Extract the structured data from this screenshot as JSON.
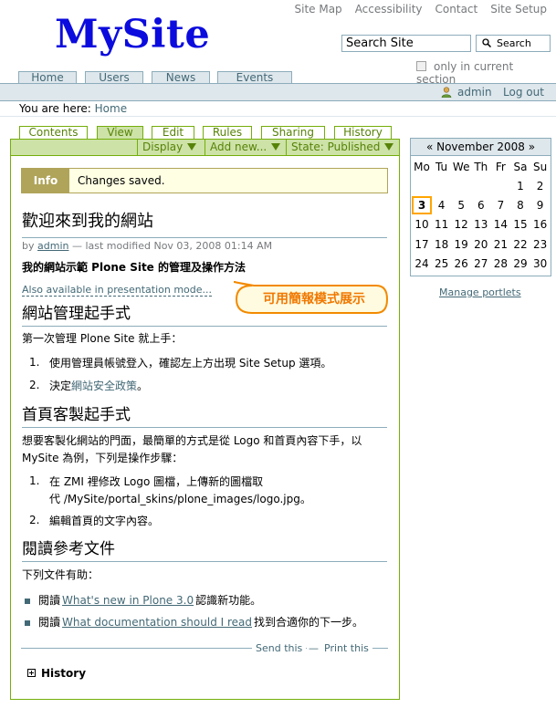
{
  "site_actions": [
    "Site Map",
    "Accessibility",
    "Contact",
    "Site Setup"
  ],
  "logo": "MySite",
  "search": {
    "value": "Search Site",
    "button": "Search",
    "only_current": "only in current section"
  },
  "global_tabs": [
    "Home",
    "Users",
    "News",
    "Events"
  ],
  "personal": {
    "user": "admin",
    "logout": "Log out"
  },
  "breadcrumb": {
    "prefix": "You are here:",
    "home": "Home"
  },
  "content_tabs": [
    "Contents",
    "View",
    "Edit",
    "Rules",
    "Sharing",
    "History"
  ],
  "content_actions": [
    "Display",
    "Add new...",
    "State: Published"
  ],
  "info": {
    "label": "Info",
    "text": "Changes saved."
  },
  "doc": {
    "title": "歡迎來到我的網站",
    "byline_by": "by",
    "byline_author": "admin",
    "byline_rest": "— last modified Nov 03, 2008 01:14 AM",
    "description": "我的網站示範 Plone Site 的管理及操作方法",
    "presentation_link": "Also available in presentation mode...",
    "callout": "可用簡報模式展示",
    "section1": {
      "heading": "網站管理起手式",
      "intro": "第一次管理 Plone Site 就上手：",
      "items": [
        "使用管理員帳號登入，確認左上方出現 Site Setup 選項。",
        "決定網站安全政策。"
      ],
      "item2_prefix": "決定",
      "item2_link": "網站安全政策",
      "item2_suffix": "。"
    },
    "section2": {
      "heading": "首頁客製起手式",
      "intro_line1": "想要客製化網站的門面，最簡單的方式是從 Logo 和首頁內容下手，以",
      "intro_line2": "MySite 為例，下列是操作步驟：",
      "item1_line1": "在 ZMI 裡修改 Logo 圖檔，上傳新的圖檔取",
      "item1_line2": "代 /MySite/portal_skins/plone_images/logo.jpg。",
      "item2": "編輯首頁的文字內容。"
    },
    "section3": {
      "heading": "閱讀參考文件",
      "intro": "下列文件有助：",
      "item1_prefix": "閱讀",
      "item1_link": "What's new in Plone 3.0",
      "item1_suffix": "認識新功能。",
      "item2_prefix": "閱讀",
      "item2_link": "What documentation should I read",
      "item2_suffix": "找到合適你的下一步。"
    },
    "send_this": "Send this",
    "print_this": "Print this",
    "history": "History"
  },
  "calendar": {
    "header": "« November 2008 »",
    "day_names": [
      "Mo",
      "Tu",
      "We",
      "Th",
      "Fr",
      "Sa",
      "Su"
    ],
    "weeks": [
      [
        "",
        "",
        "",
        "",
        "",
        "1",
        "2"
      ],
      [
        "3",
        "4",
        "5",
        "6",
        "7",
        "8",
        "9"
      ],
      [
        "10",
        "11",
        "12",
        "13",
        "14",
        "15",
        "16"
      ],
      [
        "17",
        "18",
        "19",
        "20",
        "21",
        "22",
        "23"
      ],
      [
        "24",
        "25",
        "26",
        "27",
        "28",
        "29",
        "30"
      ]
    ],
    "today": "3"
  },
  "manage_portlets": "Manage portlets",
  "colors": {
    "link": "#436976",
    "tab_border": "#8cacbb",
    "content_green": "#74ae0b",
    "green_fill": "#cde2a7",
    "info_fill": "#ffffe3",
    "highlight": "#ffa500"
  }
}
